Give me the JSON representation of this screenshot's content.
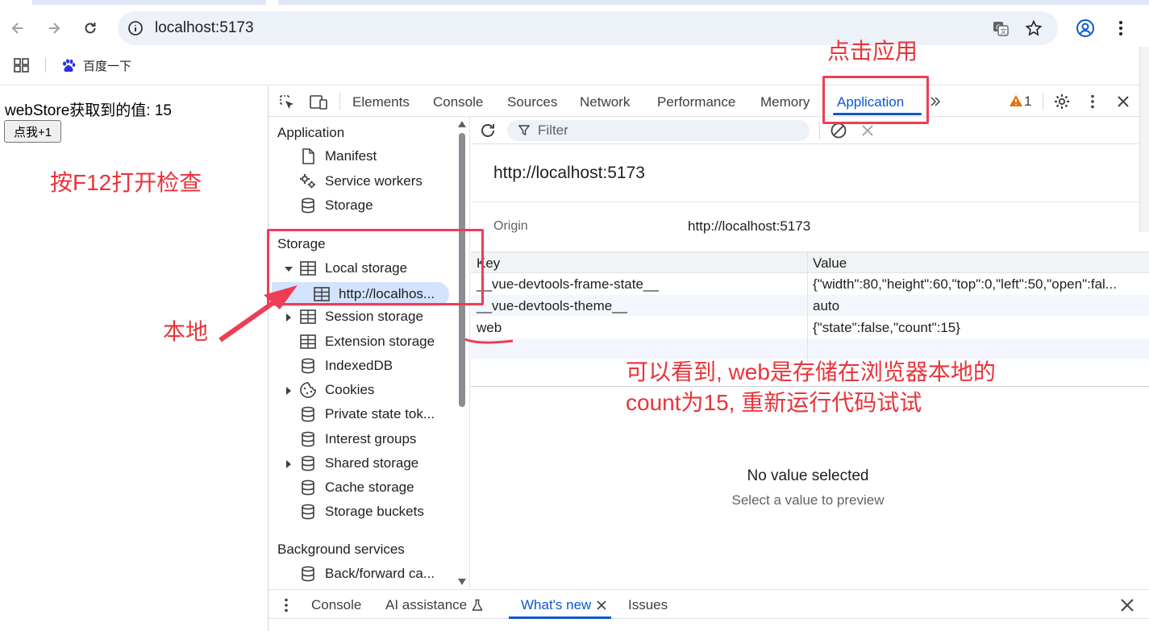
{
  "browser": {
    "url": "localhost:5173",
    "bookmarks": [
      {
        "label": "百度一下"
      }
    ]
  },
  "page": {
    "store_text": "webStore获取到的值: 15",
    "button_label": "点我+1"
  },
  "devtools": {
    "tabs": [
      "Elements",
      "Console",
      "Sources",
      "Network",
      "Performance",
      "Memory",
      "Application"
    ],
    "active_tab": "Application",
    "warning_count": "1",
    "sidebar": {
      "application_header": "Application",
      "application_items": [
        "Manifest",
        "Service workers",
        "Storage"
      ],
      "storage_header": "Storage",
      "storage_items": {
        "local_storage": "Local storage",
        "local_origin": "http://localhos...",
        "session_storage": "Session storage",
        "extension_storage": "Extension storage",
        "indexeddb": "IndexedDB",
        "cookies": "Cookies",
        "private_state": "Private state tok...",
        "interest_groups": "Interest groups",
        "shared_storage": "Shared storage",
        "cache_storage": "Cache storage",
        "storage_buckets": "Storage buckets"
      },
      "background_header": "Background services",
      "background_items": [
        "Back/forward ca..."
      ]
    },
    "main": {
      "filter_placeholder": "Filter",
      "origin_title": "http://localhost:5173",
      "origin_label": "Origin",
      "origin_value": "http://localhost:5173",
      "table": {
        "headers": [
          "Key",
          "Value"
        ],
        "rows": [
          {
            "key": "__vue-devtools-frame-state__",
            "value": "{\"width\":80,\"height\":60,\"top\":0,\"left\":50,\"open\":fal..."
          },
          {
            "key": "__vue-devtools-theme__",
            "value": "auto"
          },
          {
            "key": "web",
            "value": "{\"state\":false,\"count\":15}"
          }
        ]
      },
      "no_value_title": "No value selected",
      "no_value_sub": "Select a value to preview"
    },
    "drawer": {
      "tabs": [
        "Console",
        "AI assistance",
        "What's new",
        "Issues"
      ],
      "active_tab": "What's new"
    }
  },
  "annotations": {
    "click_app": "点击应用",
    "press_f12": "按F12打开检查",
    "local": "本地",
    "note_line1": "可以看到, web是存储在浏览器本地的",
    "note_line2": "count为15, 重新运行代码试试"
  },
  "colors": {
    "accent": "#0b57d0",
    "annotation_red": "#e8343a",
    "selected_bg": "#d3e3fd",
    "warning": "#e37400"
  }
}
